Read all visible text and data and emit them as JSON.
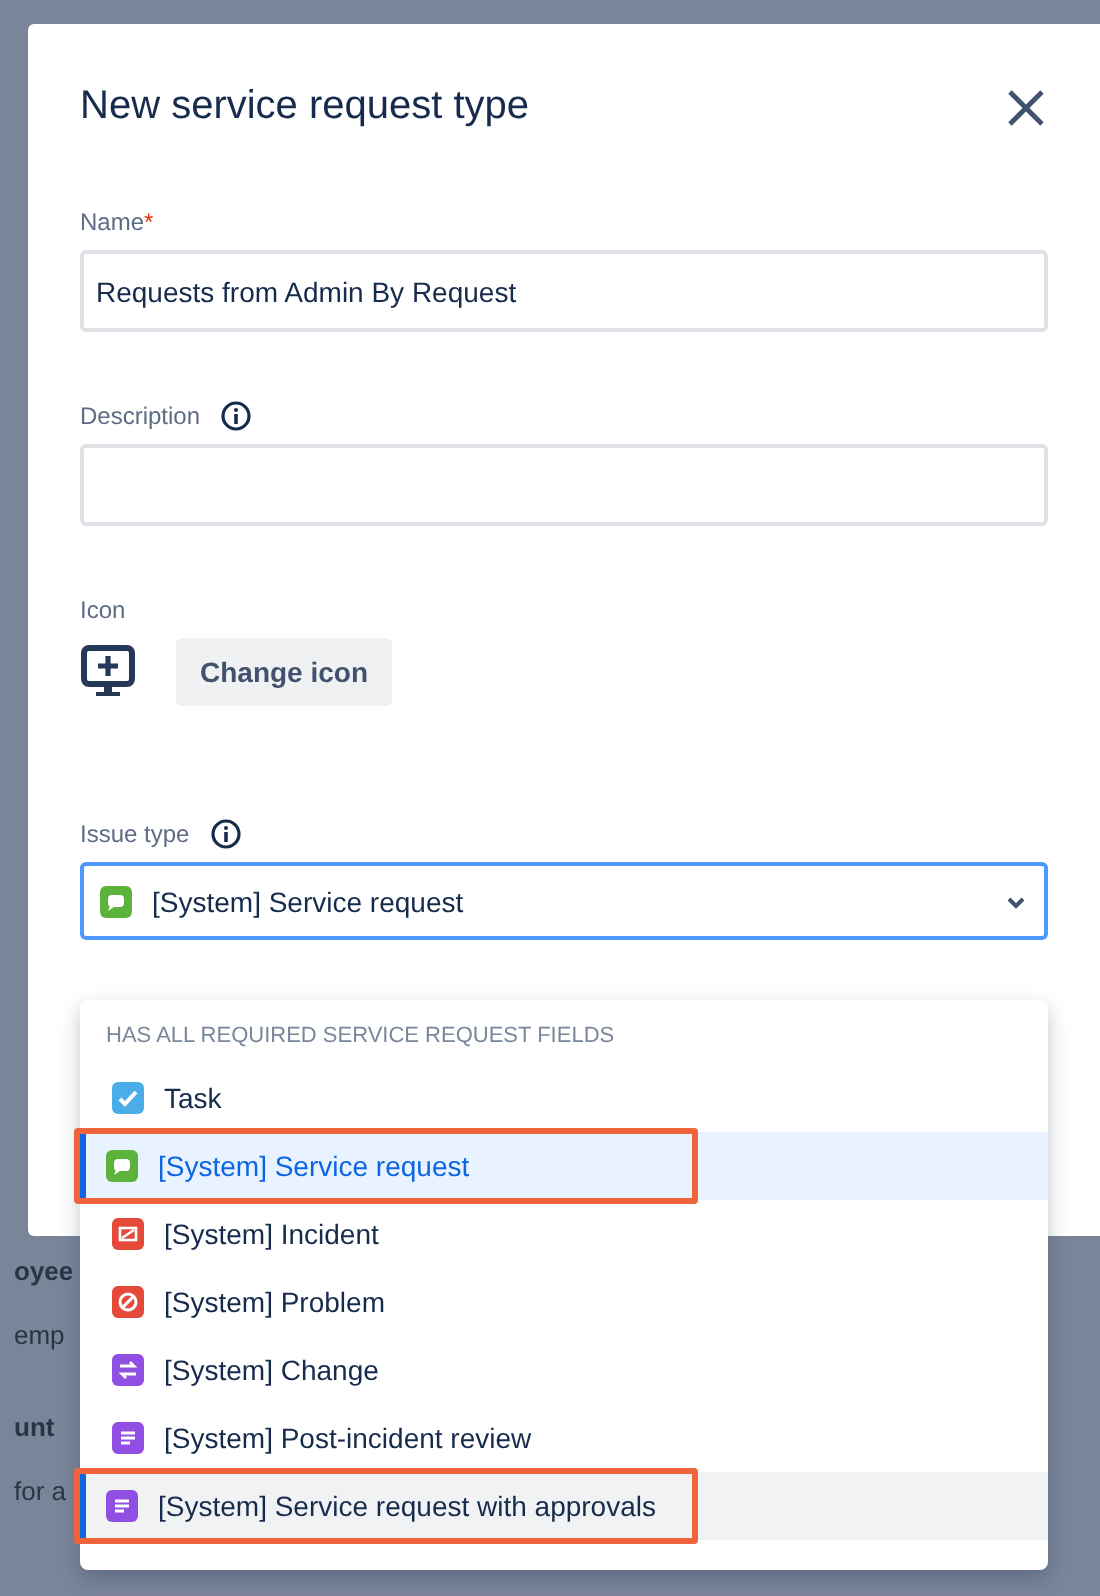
{
  "background": {
    "fragments": [
      {
        "text": "oyee",
        "kind": "heading"
      },
      {
        "text": "emp",
        "kind": "body"
      },
      {
        "text": "unt",
        "kind": "heading"
      },
      {
        "text": "for a",
        "kind": "body"
      }
    ]
  },
  "dialog": {
    "title": "New service request type",
    "fields": [
      {
        "kind": "text",
        "label": "Name",
        "required_mark": "*",
        "value": "Requests from Admin By Request"
      },
      {
        "kind": "text",
        "label": "Description",
        "info": true
      },
      {
        "kind": "icon",
        "label": "Icon",
        "button": "Change icon"
      },
      {
        "kind": "select",
        "label": "Issue type",
        "info": true,
        "value": "[System] Service request",
        "focused": true
      }
    ]
  },
  "dropdown": {
    "group_heading": "HAS ALL REQUIRED SERVICE REQUEST FIELDS",
    "options": [
      {
        "label": "Task",
        "kind": "task",
        "color": "#4bade8",
        "selected": false,
        "hovered": false,
        "annotated": false
      },
      {
        "label": "[System] Service request",
        "kind": "service",
        "color": "#5bb33b",
        "selected": true,
        "hovered": false,
        "annotated": true
      },
      {
        "label": "[System] Incident",
        "kind": "incident",
        "color": "#e5493a",
        "selected": false,
        "hovered": false,
        "annotated": false
      },
      {
        "label": "[System] Problem",
        "kind": "problem",
        "color": "#e5493a",
        "selected": false,
        "hovered": false,
        "annotated": false
      },
      {
        "label": "[System] Change",
        "kind": "change",
        "color": "#904ee2",
        "selected": false,
        "hovered": false,
        "annotated": false
      },
      {
        "label": "[System] Post-incident review",
        "kind": "review",
        "color": "#904ee2",
        "selected": false,
        "hovered": false,
        "annotated": false
      },
      {
        "label": "[System] Service request with approvals",
        "kind": "review",
        "color": "#904ee2",
        "selected": false,
        "hovered": true,
        "annotated": true
      }
    ]
  }
}
